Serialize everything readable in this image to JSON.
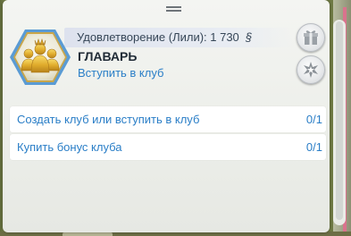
{
  "panel": {
    "satisfaction_label": "Удовлетворение (Лили): 1 730",
    "currency_symbol": "§",
    "rank_title": "ГЛАВАРЬ",
    "rank_subtitle": "Вступить в клуб",
    "badge_icon": "gold-group-leader-icon",
    "buttons": {
      "gift_icon": "gift-icon",
      "star_icon": "star-burst-icon"
    }
  },
  "tasks": [
    {
      "label": "Создать клуб или вступить в клуб",
      "progress": "0/1"
    },
    {
      "label": "Купить бонус клуба",
      "progress": "0/1"
    }
  ],
  "colors": {
    "accent_blue": "#2a7ec7",
    "badge_gold": "#d9a42a",
    "badge_frame": "#5a9bd4"
  }
}
